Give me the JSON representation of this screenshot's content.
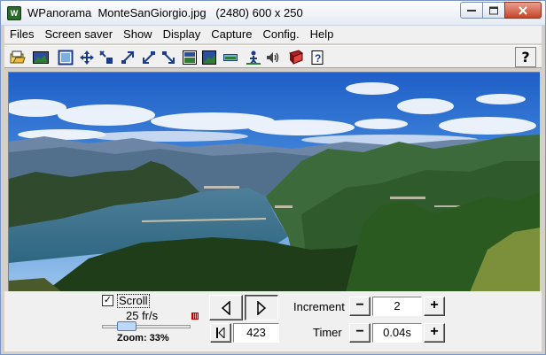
{
  "window": {
    "title": "WPanorama  MonteSanGiorgio.jpg   (2480) 600 x 250",
    "app_icon_text": "W",
    "accent_color": "#c7442a"
  },
  "menu": [
    "Files",
    "Screen saver",
    "Show",
    "Display",
    "Capture",
    "Config.",
    "Help"
  ],
  "toolbar": {
    "icons": [
      "open-folder-icon",
      "landscape-icon",
      "frame-icon",
      "move-icon",
      "shrink-icon",
      "expand-up-icon",
      "arrow-down-left-icon",
      "arrow-down-right-icon",
      "fit-window-icon",
      "image-window-icon",
      "strip-icon",
      "person-icon",
      "sound-icon",
      "book-icon",
      "help-page-icon"
    ],
    "help_label": "?"
  },
  "controls": {
    "scroll_checked": "✓",
    "scroll_label": "Scroll",
    "speed": "25 fr/s",
    "zoom": "Zoom: 33%",
    "zoom_percent": 33,
    "position": "423",
    "increment_label": "Increment",
    "increment_value": "2",
    "timer_label": "Timer",
    "timer_value": "0.04s",
    "minus": "−",
    "plus": "+"
  }
}
